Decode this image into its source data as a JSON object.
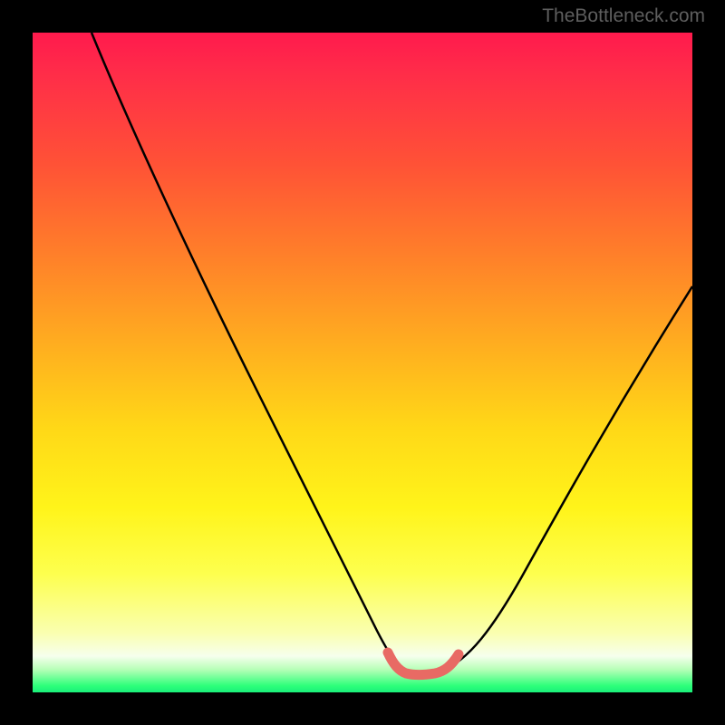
{
  "watermark": "TheBottleneck.com",
  "chart_data": {
    "type": "line",
    "title": "",
    "xlabel": "",
    "ylabel": "",
    "xlim": [
      0,
      100
    ],
    "ylim": [
      0,
      100
    ],
    "series": [
      {
        "name": "black-curve",
        "x": [
          9,
          12,
          18,
          25,
          32,
          40,
          48,
          52,
          55,
          57.5,
          60,
          63,
          66,
          70,
          77,
          85,
          92,
          100
        ],
        "values": [
          100,
          89,
          74,
          60,
          47,
          33,
          17,
          8,
          4,
          3.2,
          3.2,
          3.8,
          5.5,
          9.5,
          20,
          34,
          48,
          62
        ]
      },
      {
        "name": "pink-bottom-segment",
        "x": [
          54.5,
          55.5,
          57,
          58.5,
          60,
          61.5,
          63,
          64,
          65
        ],
        "values": [
          5.3,
          4.1,
          3.3,
          3.1,
          3.1,
          3.2,
          3.6,
          4.2,
          5.6
        ]
      }
    ],
    "colors": {
      "black_curve": "#000000",
      "pink_segment": "#e86a64",
      "gradient_top": "#ff1a4d",
      "gradient_bottom": "#1af07a"
    }
  }
}
